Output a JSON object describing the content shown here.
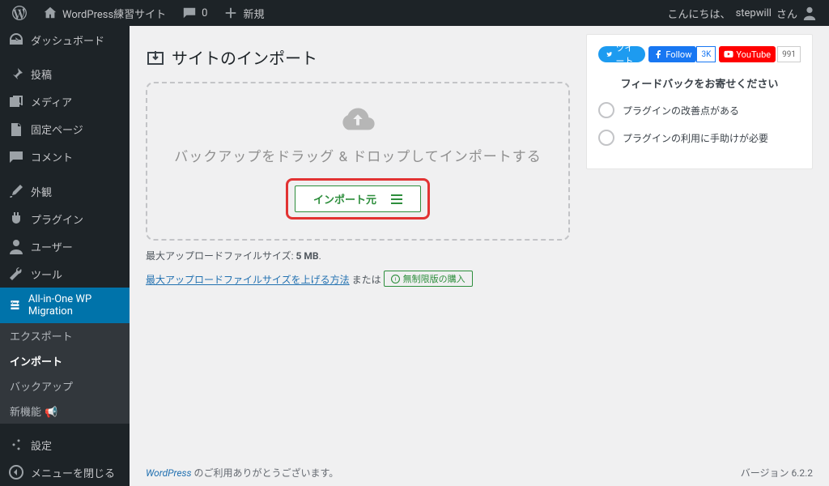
{
  "adminbar": {
    "site_title": "WordPress練習サイト",
    "comment_count": "0",
    "new_label": "新規",
    "greeting_prefix": "こんにちは、",
    "username": "stepwill",
    "greeting_suffix": " さん"
  },
  "sidemenu": {
    "dashboard": "ダッシュボード",
    "posts": "投稿",
    "media": "メディア",
    "pages": "固定ページ",
    "comments": "コメント",
    "appearance": "外観",
    "plugins": "プラグイン",
    "users": "ユーザー",
    "tools": "ツール",
    "ai1wm": "All-in-One WP Migration",
    "submenu": {
      "export": "エクスポート",
      "import": "インポート",
      "backups": "バックアップ",
      "whatsnew": "新機能"
    },
    "settings": "設定",
    "collapse": "メニューを閉じる"
  },
  "page": {
    "title": "サイトのインポート",
    "drop_text": "バックアップをドラッグ & ドロップしてインポートする",
    "import_from": "インポート元",
    "max_upload_label": "最大アップロードファイルサイズ:",
    "max_upload_value": "5 MB",
    "increase_link": "最大アップロードファイルサイズを上げる方法",
    "or_text": "または",
    "unlimited_label": "無制限版の購入"
  },
  "sidebar": {
    "tweet": "ツイート",
    "fb_follow": "Follow",
    "fb_count": "3K",
    "youtube": "YouTube",
    "yt_count": "991",
    "feedback_title": "フィードバックをお寄せください",
    "option1": "プラグインの改善点がある",
    "option2": "プラグインの利用に手助けが必要"
  },
  "footer": {
    "wp_link": "WordPress",
    "thanks": " のご利用ありがとうございます。",
    "version_label": "バージョン ",
    "version": "6.2.2"
  }
}
